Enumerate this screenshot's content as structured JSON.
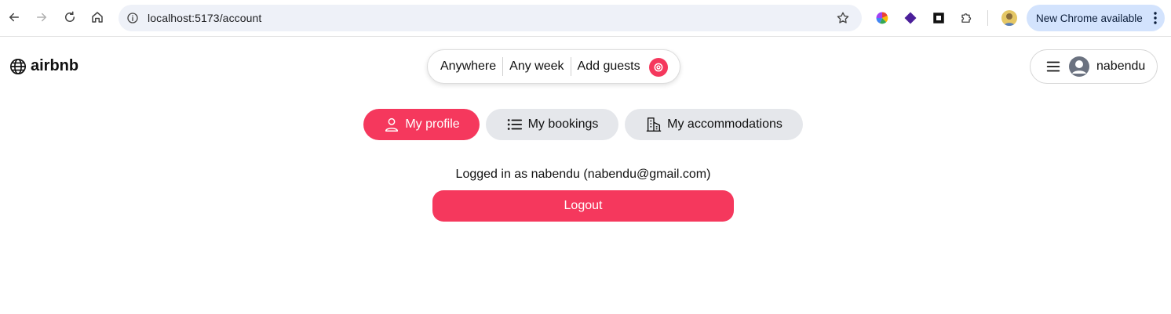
{
  "browser": {
    "url": "localhost:5173/account",
    "update_label": "New Chrome available"
  },
  "app": {
    "logo_text": "airbnb",
    "search": {
      "where": "Anywhere",
      "when": "Any week",
      "who": "Add guests"
    },
    "user_name": "nabendu"
  },
  "tabs": [
    {
      "label": "My profile",
      "icon": "user-icon",
      "active": true
    },
    {
      "label": "My bookings",
      "icon": "list-icon",
      "active": false
    },
    {
      "label": "My accommodations",
      "icon": "building-icon",
      "active": false
    }
  ],
  "profile": {
    "logged_in_text": "Logged in as nabendu (nabendu@gmail.com)",
    "logout_label": "Logout"
  },
  "colors": {
    "accent": "#f5385d",
    "tab_inactive": "#e5e7eb",
    "update_pill": "#d3e3fd"
  }
}
